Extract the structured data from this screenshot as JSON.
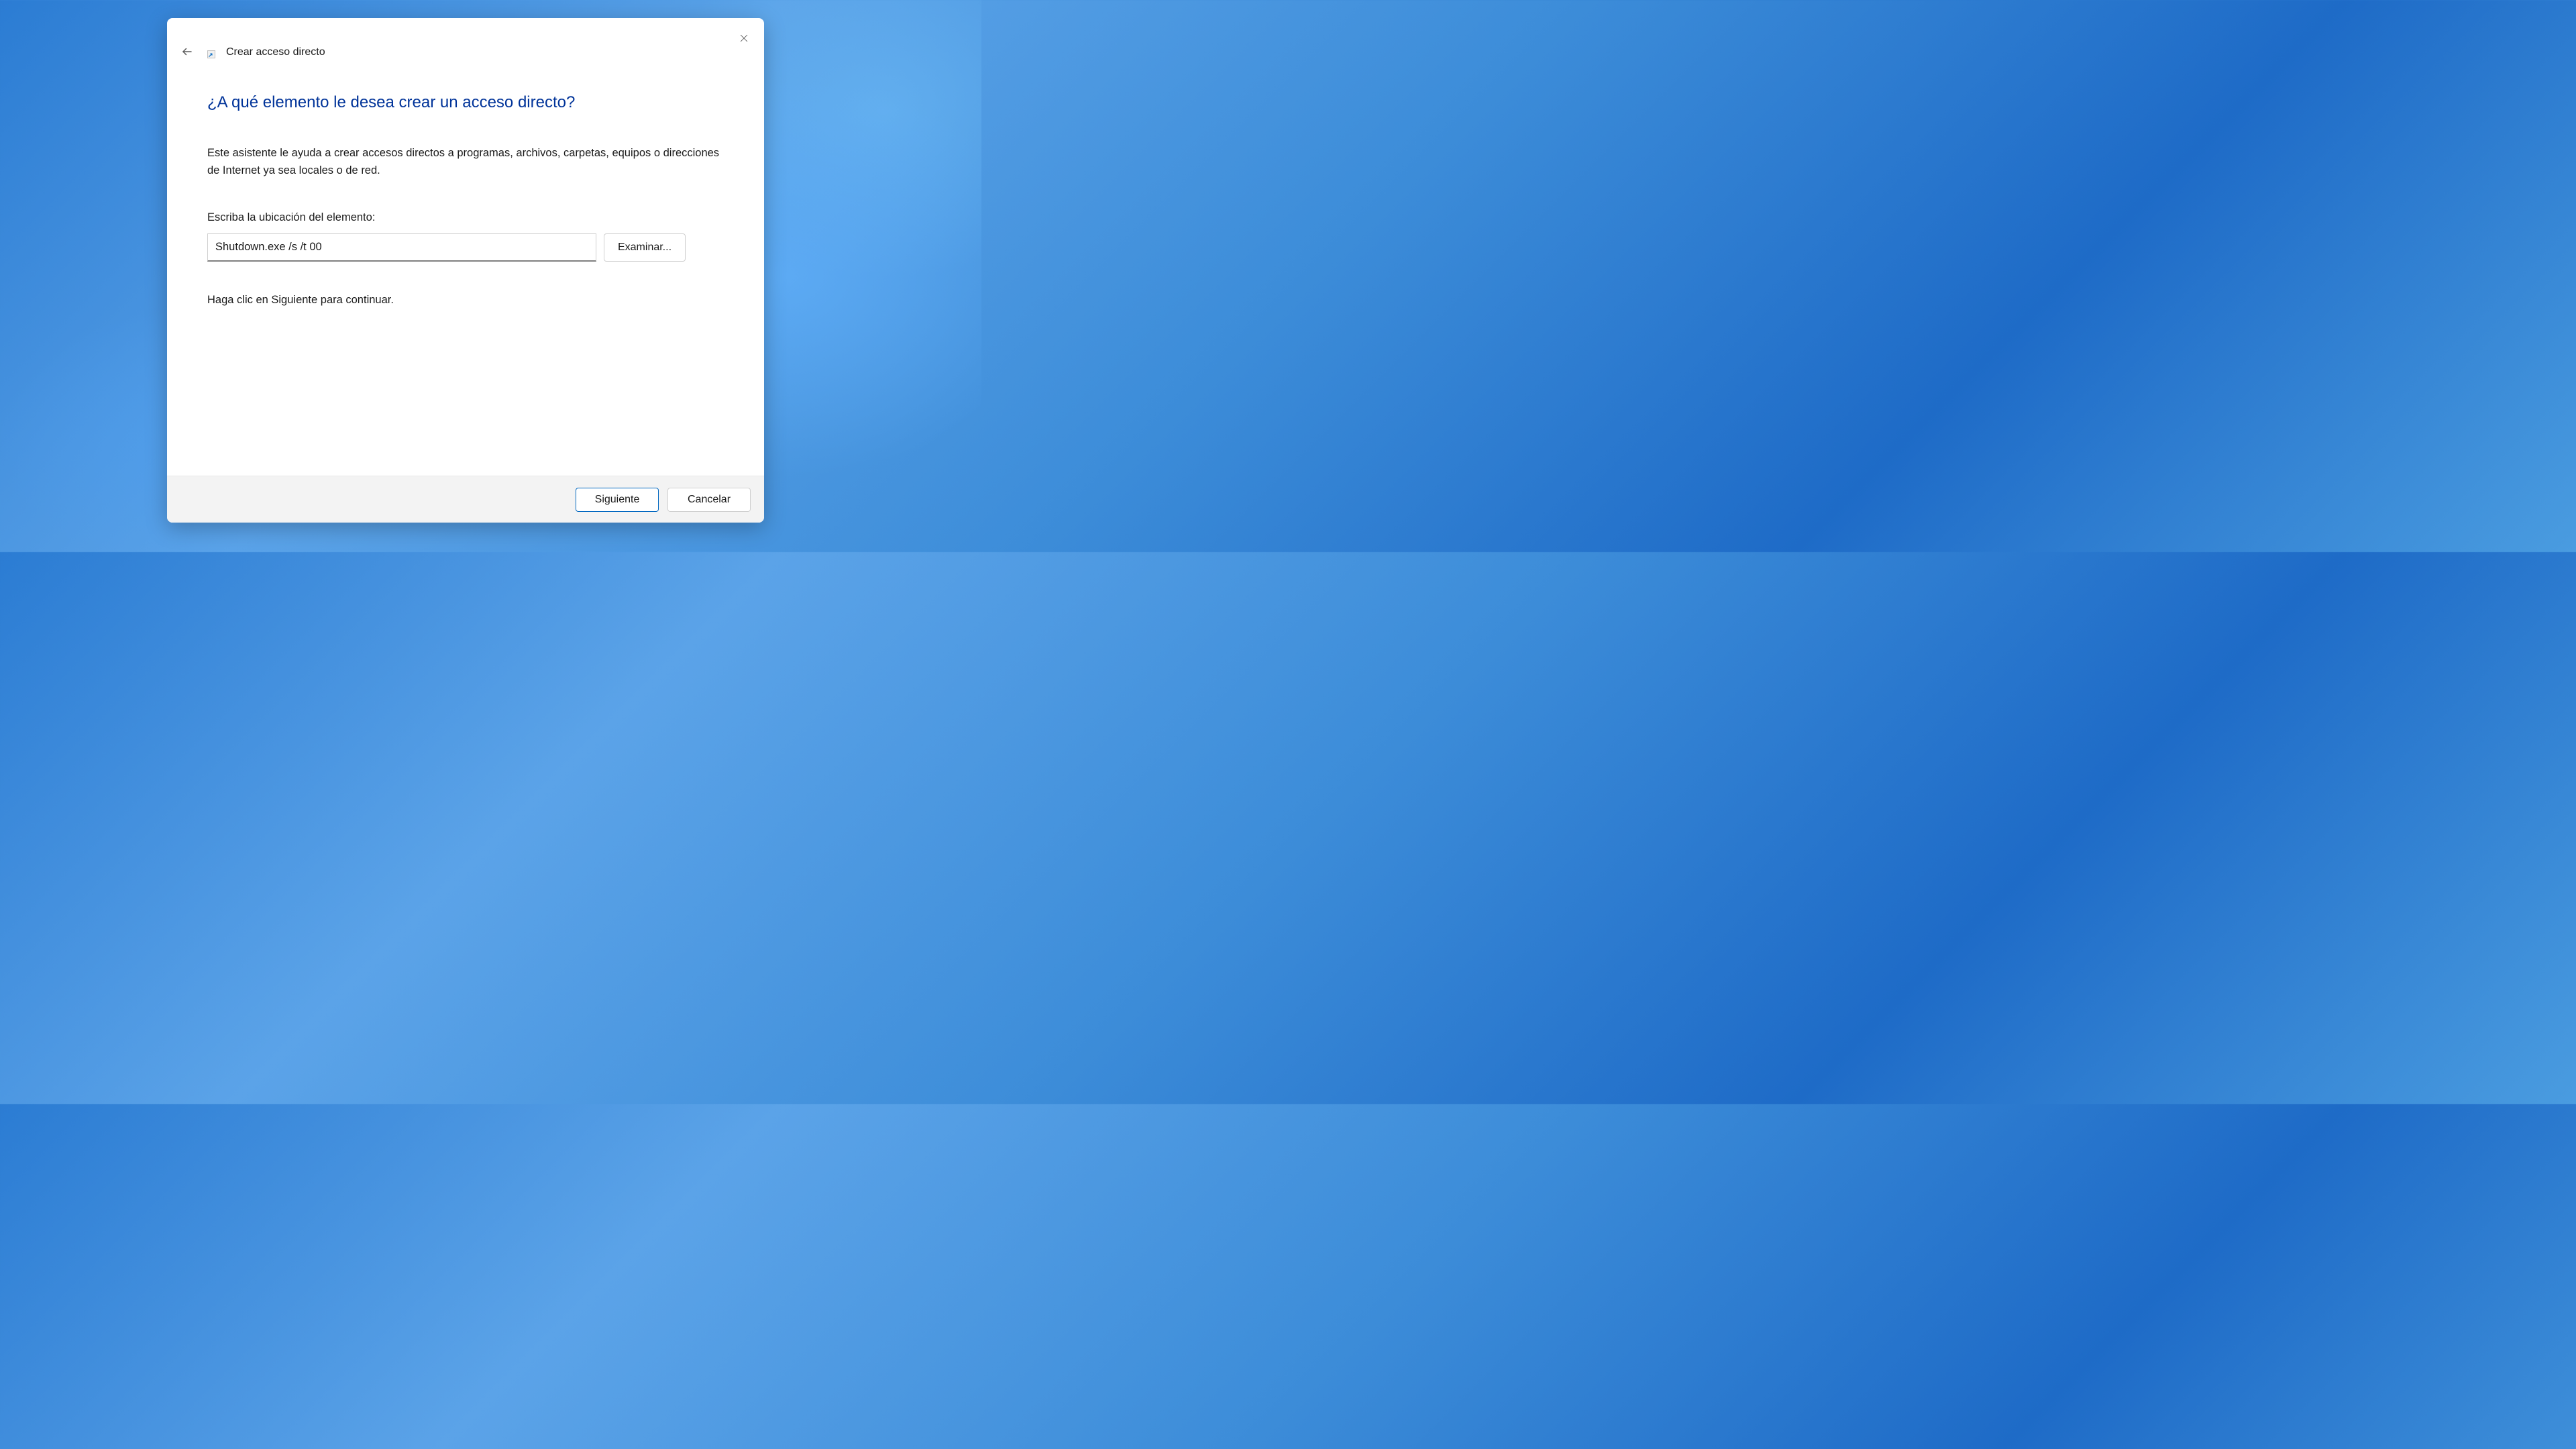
{
  "dialog": {
    "title": "Crear acceso directo",
    "heading": "¿A qué elemento le desea crear un acceso directo?",
    "description": "Este asistente le ayuda a crear accesos directos a programas, archivos, carpetas, equipos o direcciones de Internet ya sea locales o de red.",
    "field_label": "Escriba la ubicación del elemento:",
    "location_value": "Shutdown.exe /s /t 00",
    "browse_label": "Examinar...",
    "instruction": "Haga clic en Siguiente para continuar.",
    "next_label": "Siguiente",
    "cancel_label": "Cancelar"
  }
}
